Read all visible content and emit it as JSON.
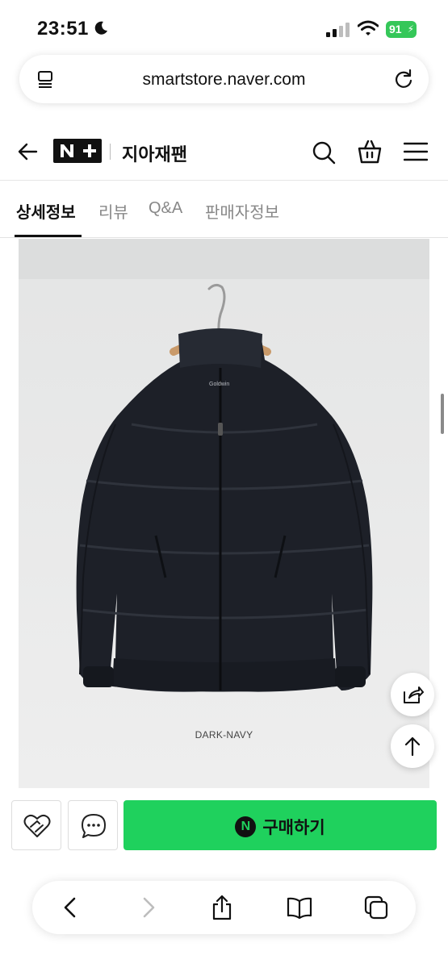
{
  "status_bar": {
    "time": "23:51",
    "battery": "91"
  },
  "browser": {
    "url": "smartstore.naver.com"
  },
  "header": {
    "logo": "N+",
    "store_name": "지아재팬"
  },
  "tabs": [
    {
      "label": "상세정보",
      "active": true
    },
    {
      "label": "리뷰",
      "active": false
    },
    {
      "label": "Q&A",
      "active": false
    },
    {
      "label": "판매자정보",
      "active": false
    }
  ],
  "product": {
    "brand_mark": "Goldwin",
    "color_label": "DARK-NAVY"
  },
  "purchase": {
    "buy_label": "구매하기",
    "npay_mark": "N"
  },
  "colors": {
    "buy_green": "#1fd15d",
    "battery_green": "#35c759",
    "background": "#ffffff"
  }
}
